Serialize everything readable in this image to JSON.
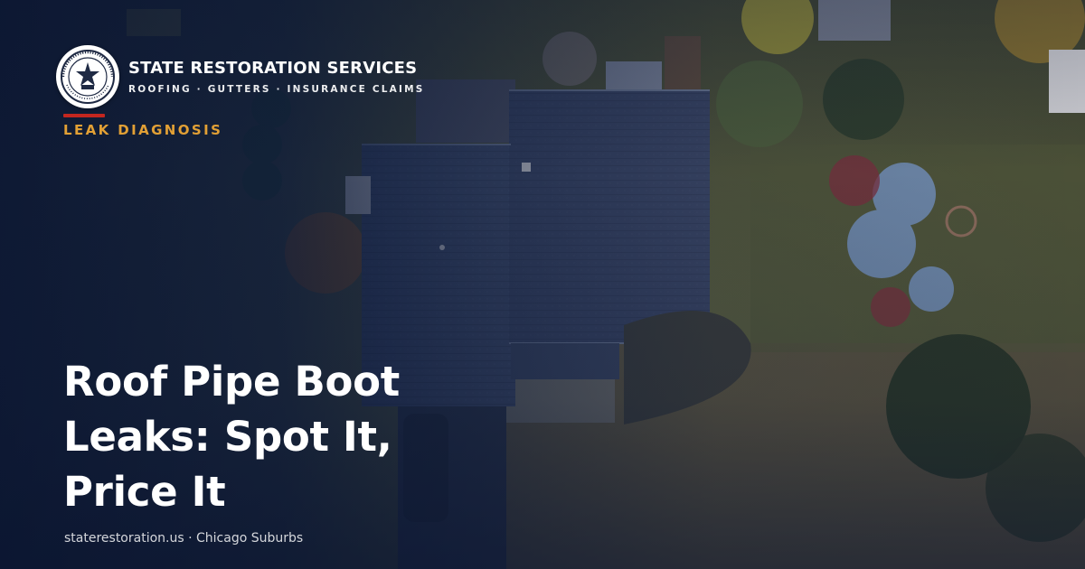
{
  "brand": {
    "name": "STATE RESTORATION SERVICES",
    "tagline": "ROOFING · GUTTERS · INSURANCE CLAIMS",
    "logo_seal_text": "STATE RESTORATION SERVICES EST. 2015"
  },
  "category": "LEAK DIAGNOSIS",
  "headline": {
    "line1": "Roof Pipe Boot",
    "line2": "Leaks: Spot It,",
    "line3": "Price It"
  },
  "footer": {
    "site": "staterestoration.us",
    "separator": " · ",
    "location": "Chicago Suburbs"
  },
  "colors": {
    "accent_red": "#c3261f",
    "category_gold": "#e2a035",
    "overlay_navy": "#0c1a3a",
    "text": "#ffffff"
  }
}
